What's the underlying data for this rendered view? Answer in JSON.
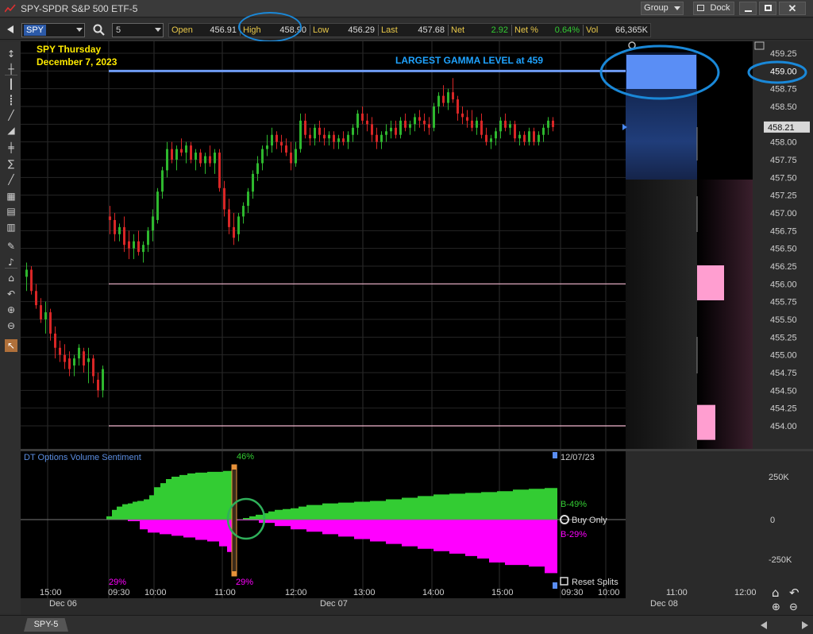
{
  "window": {
    "title": "SPY-SPDR S&P 500 ETF-5",
    "group_label": "Group",
    "dock_label": "Dock"
  },
  "toolbar": {
    "symbol": "SPY",
    "interval": "5",
    "quotes": [
      {
        "label": "Open",
        "value": "456.91"
      },
      {
        "label": "High",
        "value": "458.90"
      },
      {
        "label": "Low",
        "value": "456.29"
      },
      {
        "label": "Last",
        "value": "457.68"
      },
      {
        "label": "Net",
        "value": "2.92"
      },
      {
        "label": "Net %",
        "value": "0.64%"
      },
      {
        "label": "Vol",
        "value": "66,365K"
      }
    ],
    "colors": {
      "label": "#e8c84a",
      "value": "#dddddd",
      "positive": "#33cc33",
      "highlight": "#1a88d8"
    }
  },
  "chart": {
    "annotation_title": "SPY Thursday",
    "annotation_date": "December 7, 2023",
    "gamma_label": "LARGEST GAMMA LEVEL at 459",
    "current_price": "458.21",
    "highlighted_price": "459.00",
    "price_ticks": [
      "459.25",
      "459.00",
      "458.75",
      "458.50",
      "458.25",
      "458.00",
      "457.75",
      "457.50",
      "457.25",
      "457.00",
      "456.75",
      "456.50",
      "456.25",
      "456.00",
      "455.75",
      "455.50",
      "455.25",
      "455.00",
      "454.75",
      "454.50",
      "454.25",
      "454.00"
    ],
    "time_ticks": [
      "15:00",
      "09:30",
      "10:00",
      "11:00",
      "12:00",
      "13:00",
      "14:00",
      "15:00",
      "09:30",
      "10:00",
      "11:00",
      "12:00"
    ],
    "date_labels": [
      "Dec 06",
      "Dec 07",
      "Dec 08"
    ],
    "colors": {
      "up": "#2eb82e",
      "down": "#d92626",
      "gamma_line": "#6f9cf5",
      "support_line": "#f4b8d0",
      "annotation": "#ffeb00",
      "gamma_text": "#1fa3ff"
    }
  },
  "indicator": {
    "title": "DT Options Volume Sentiment",
    "top_pct": "46%",
    "bottom_pct_left": "29%",
    "bottom_pct_mid": "29%",
    "date": "12/07/23",
    "buy_label": "B-49%",
    "sell_label": "B-29%",
    "buy_only_label": "Buy Only",
    "reset_splits_label": "Reset Splits",
    "axis_ticks": [
      "250K",
      "0",
      "-250K"
    ],
    "colors": {
      "buy": "#33cc33",
      "sell": "#ff00ff",
      "marker": "#e8923a"
    }
  },
  "status": {
    "tab_label": "SPY-5"
  }
}
